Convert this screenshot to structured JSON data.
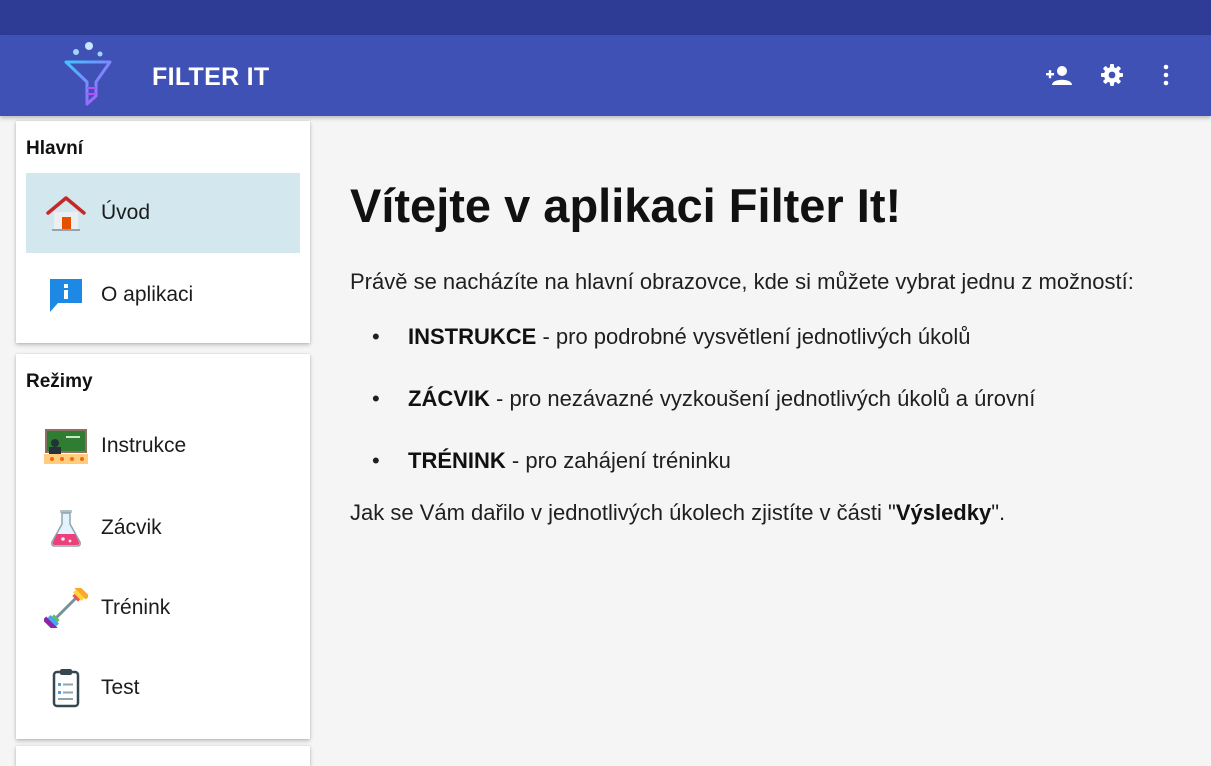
{
  "app_bar": {
    "title": "FILTER IT",
    "logo_icon": "funnel-logo-icon",
    "actions": [
      {
        "icon": "add-user-icon"
      },
      {
        "icon": "gear-icon"
      },
      {
        "icon": "more-vertical-icon"
      }
    ],
    "colors": {
      "status_bar": "#2f3c96",
      "app_bar": "#3f51b5"
    }
  },
  "sidebar": {
    "sections": [
      {
        "header": "Hlavní",
        "items": [
          {
            "label": "Úvod",
            "icon": "home-icon",
            "active": true
          },
          {
            "label": "O aplikaci",
            "icon": "info-icon",
            "active": false
          }
        ]
      },
      {
        "header": "Režimy",
        "items": [
          {
            "label": "Instrukce",
            "icon": "classroom-icon",
            "active": false
          },
          {
            "label": "Zácvik",
            "icon": "flask-icon",
            "active": false
          },
          {
            "label": "Trénink",
            "icon": "dumbbell-icon",
            "active": false
          },
          {
            "label": "Test",
            "icon": "clipboard-icon",
            "active": false
          }
        ]
      }
    ],
    "active_color": "#d2e8ee"
  },
  "main": {
    "title": "Vítejte v aplikaci Filter It!",
    "intro": "Právě se nacházíte na hlavní obrazovce, kde si můžete vybrat jednu z možností:",
    "options": [
      {
        "name": "INSTRUKCE",
        "description": " - pro podrobné vysvětlení jednotlivých úkolů"
      },
      {
        "name": "ZÁCVIK",
        "description": " - pro nezávazné vyzkoušení jednotlivých úkolů a úrovní"
      },
      {
        "name": "TRÉNINK",
        "description": " - pro zahájení tréninku"
      }
    ],
    "results_prefix": "Jak se Vám dařilo v jednotlivých úkolech zjistíte v části \"",
    "results_link": "Výsledky",
    "results_suffix": "\"."
  }
}
